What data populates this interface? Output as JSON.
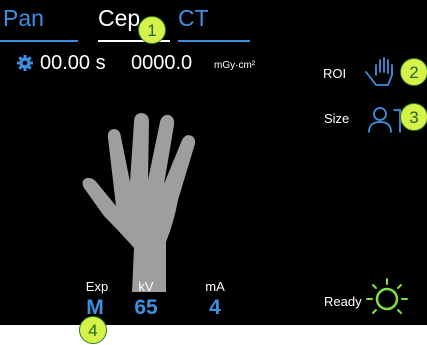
{
  "tabs": [
    {
      "label": "Pan",
      "active": false
    },
    {
      "label": "Cep",
      "active": true
    },
    {
      "label": "CT",
      "active": false
    }
  ],
  "stats": {
    "time_value": "00.00 s",
    "dose_value": "0000.0",
    "dose_unit": "mGy·cm²",
    "icon": "gear-icon"
  },
  "side": {
    "roi_label": "ROI",
    "roi_icon": "hand-select-icon",
    "size_label": "Size",
    "size_icon": "head-size-icon"
  },
  "exposure": {
    "exp_label": "Exp",
    "exp_value": "M",
    "kv_label": "kV",
    "kv_value": "65",
    "ma_label": "mA",
    "ma_value": "4"
  },
  "status": {
    "ready_label": "Ready",
    "ready_icon": "ready-spinner-icon"
  },
  "callouts": [
    "1",
    "2",
    "3",
    "4"
  ],
  "colors": {
    "accent": "#3d8fe0",
    "ready_green": "#7de04a",
    "callout_fill": "#d6f24a",
    "background": "#000000",
    "hand_gray": "#9e9e9e"
  }
}
